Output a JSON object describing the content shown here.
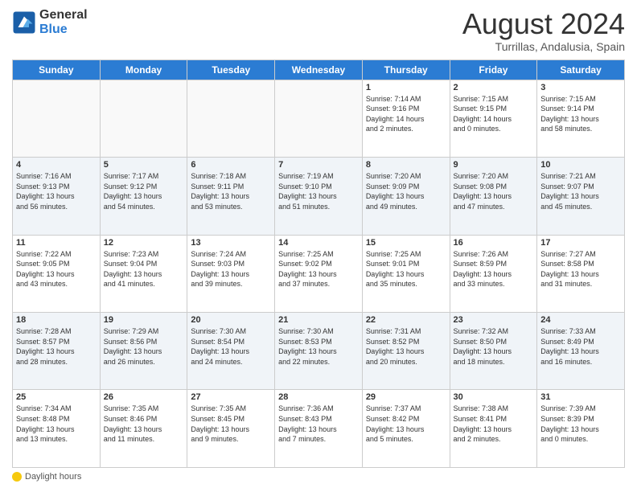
{
  "header": {
    "logo_line1": "General",
    "logo_line2": "Blue",
    "title": "August 2024",
    "subtitle": "Turrillas, Andalusia, Spain"
  },
  "footer": {
    "label": "Daylight hours"
  },
  "weekdays": [
    "Sunday",
    "Monday",
    "Tuesday",
    "Wednesday",
    "Thursday",
    "Friday",
    "Saturday"
  ],
  "weeks": [
    [
      {
        "day": "",
        "info": ""
      },
      {
        "day": "",
        "info": ""
      },
      {
        "day": "",
        "info": ""
      },
      {
        "day": "",
        "info": ""
      },
      {
        "day": "1",
        "info": "Sunrise: 7:14 AM\nSunset: 9:16 PM\nDaylight: 14 hours\nand 2 minutes."
      },
      {
        "day": "2",
        "info": "Sunrise: 7:15 AM\nSunset: 9:15 PM\nDaylight: 14 hours\nand 0 minutes."
      },
      {
        "day": "3",
        "info": "Sunrise: 7:15 AM\nSunset: 9:14 PM\nDaylight: 13 hours\nand 58 minutes."
      }
    ],
    [
      {
        "day": "4",
        "info": "Sunrise: 7:16 AM\nSunset: 9:13 PM\nDaylight: 13 hours\nand 56 minutes."
      },
      {
        "day": "5",
        "info": "Sunrise: 7:17 AM\nSunset: 9:12 PM\nDaylight: 13 hours\nand 54 minutes."
      },
      {
        "day": "6",
        "info": "Sunrise: 7:18 AM\nSunset: 9:11 PM\nDaylight: 13 hours\nand 53 minutes."
      },
      {
        "day": "7",
        "info": "Sunrise: 7:19 AM\nSunset: 9:10 PM\nDaylight: 13 hours\nand 51 minutes."
      },
      {
        "day": "8",
        "info": "Sunrise: 7:20 AM\nSunset: 9:09 PM\nDaylight: 13 hours\nand 49 minutes."
      },
      {
        "day": "9",
        "info": "Sunrise: 7:20 AM\nSunset: 9:08 PM\nDaylight: 13 hours\nand 47 minutes."
      },
      {
        "day": "10",
        "info": "Sunrise: 7:21 AM\nSunset: 9:07 PM\nDaylight: 13 hours\nand 45 minutes."
      }
    ],
    [
      {
        "day": "11",
        "info": "Sunrise: 7:22 AM\nSunset: 9:05 PM\nDaylight: 13 hours\nand 43 minutes."
      },
      {
        "day": "12",
        "info": "Sunrise: 7:23 AM\nSunset: 9:04 PM\nDaylight: 13 hours\nand 41 minutes."
      },
      {
        "day": "13",
        "info": "Sunrise: 7:24 AM\nSunset: 9:03 PM\nDaylight: 13 hours\nand 39 minutes."
      },
      {
        "day": "14",
        "info": "Sunrise: 7:25 AM\nSunset: 9:02 PM\nDaylight: 13 hours\nand 37 minutes."
      },
      {
        "day": "15",
        "info": "Sunrise: 7:25 AM\nSunset: 9:01 PM\nDaylight: 13 hours\nand 35 minutes."
      },
      {
        "day": "16",
        "info": "Sunrise: 7:26 AM\nSunset: 8:59 PM\nDaylight: 13 hours\nand 33 minutes."
      },
      {
        "day": "17",
        "info": "Sunrise: 7:27 AM\nSunset: 8:58 PM\nDaylight: 13 hours\nand 31 minutes."
      }
    ],
    [
      {
        "day": "18",
        "info": "Sunrise: 7:28 AM\nSunset: 8:57 PM\nDaylight: 13 hours\nand 28 minutes."
      },
      {
        "day": "19",
        "info": "Sunrise: 7:29 AM\nSunset: 8:56 PM\nDaylight: 13 hours\nand 26 minutes."
      },
      {
        "day": "20",
        "info": "Sunrise: 7:30 AM\nSunset: 8:54 PM\nDaylight: 13 hours\nand 24 minutes."
      },
      {
        "day": "21",
        "info": "Sunrise: 7:30 AM\nSunset: 8:53 PM\nDaylight: 13 hours\nand 22 minutes."
      },
      {
        "day": "22",
        "info": "Sunrise: 7:31 AM\nSunset: 8:52 PM\nDaylight: 13 hours\nand 20 minutes."
      },
      {
        "day": "23",
        "info": "Sunrise: 7:32 AM\nSunset: 8:50 PM\nDaylight: 13 hours\nand 18 minutes."
      },
      {
        "day": "24",
        "info": "Sunrise: 7:33 AM\nSunset: 8:49 PM\nDaylight: 13 hours\nand 16 minutes."
      }
    ],
    [
      {
        "day": "25",
        "info": "Sunrise: 7:34 AM\nSunset: 8:48 PM\nDaylight: 13 hours\nand 13 minutes."
      },
      {
        "day": "26",
        "info": "Sunrise: 7:35 AM\nSunset: 8:46 PM\nDaylight: 13 hours\nand 11 minutes."
      },
      {
        "day": "27",
        "info": "Sunrise: 7:35 AM\nSunset: 8:45 PM\nDaylight: 13 hours\nand 9 minutes."
      },
      {
        "day": "28",
        "info": "Sunrise: 7:36 AM\nSunset: 8:43 PM\nDaylight: 13 hours\nand 7 minutes."
      },
      {
        "day": "29",
        "info": "Sunrise: 7:37 AM\nSunset: 8:42 PM\nDaylight: 13 hours\nand 5 minutes."
      },
      {
        "day": "30",
        "info": "Sunrise: 7:38 AM\nSunset: 8:41 PM\nDaylight: 13 hours\nand 2 minutes."
      },
      {
        "day": "31",
        "info": "Sunrise: 7:39 AM\nSunset: 8:39 PM\nDaylight: 13 hours\nand 0 minutes."
      }
    ]
  ]
}
